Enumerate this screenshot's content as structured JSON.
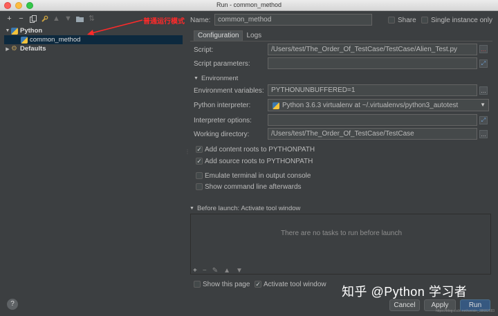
{
  "window": {
    "title": "Run - common_method"
  },
  "toolbar": {
    "icons": [
      "add-icon",
      "remove-icon",
      "copy-icon",
      "wrench-icon",
      "move-up-icon",
      "move-down-icon",
      "folder-icon",
      "sort-icon"
    ],
    "add_glyph": "+",
    "remove_glyph": "−"
  },
  "tree": {
    "python_label": "Python",
    "common_method_label": "common_method",
    "defaults_label": "Defaults"
  },
  "annotations": {
    "red_note": "普通运行模式"
  },
  "header": {
    "name_label": "Name:",
    "name_value": "common_method",
    "share_label": "Share",
    "single_instance_label": "Single instance only"
  },
  "tabs": {
    "configuration": "Configuration",
    "logs": "Logs"
  },
  "form": {
    "script_label": "Script:",
    "script_value": "/Users/test/The_Order_Of_TestCase/TestCase/Alien_Test.py",
    "script_params_label": "Script parameters:",
    "script_params_value": "",
    "environment_title": "Environment",
    "env_vars_label": "Environment variables:",
    "env_vars_value": "PYTHONUNBUFFERED=1",
    "interpreter_label": "Python interpreter:",
    "interpreter_value": "Python 3.6.3 virtualenv at ~/.virtualenvs/python3_autotest",
    "interpreter_options_label": "Interpreter options:",
    "interpreter_options_value": "",
    "working_dir_label": "Working directory:",
    "working_dir_value": "/Users/test/The_Order_Of_TestCase/TestCase",
    "add_content_roots_label": "Add content roots to PYTHONPATH",
    "add_source_roots_label": "Add source roots to PYTHONPATH",
    "emulate_terminal_label": "Emulate terminal in output console",
    "show_command_line_label": "Show command line afterwards"
  },
  "before_launch": {
    "title": "Before launch: Activate tool window",
    "empty_text": "There are no tasks to run before launch"
  },
  "footer": {
    "show_page_label": "Show this page",
    "activate_tool_label": "Activate tool window",
    "cancel_label": "Cancel",
    "apply_label": "Apply",
    "run_label": "Run",
    "help_label": "?"
  },
  "watermark": {
    "text": "知乎 @Python 学习者",
    "url_text": "https://blog.csdn.net/weixin_38682683"
  },
  "colors": {
    "background": "#3c3f41",
    "selection": "#0d293e",
    "primary_button": "#365880",
    "annotation_red": "#ff2a2a"
  }
}
